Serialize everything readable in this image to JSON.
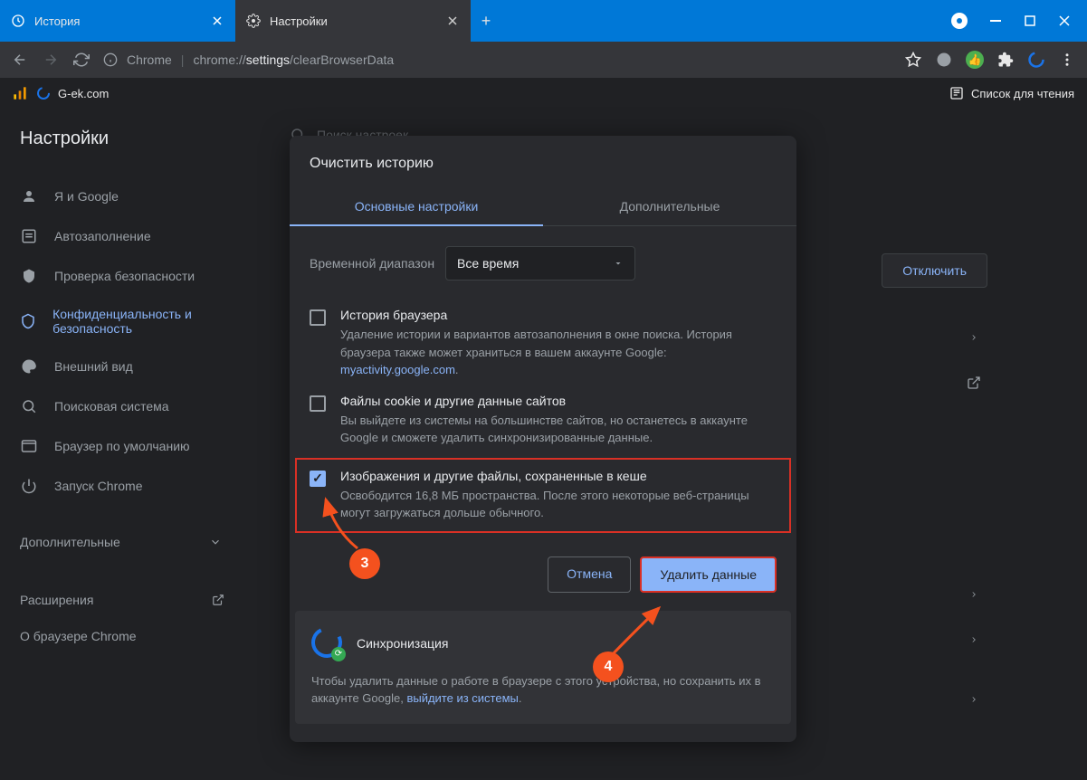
{
  "titlebar": {
    "tabs": [
      {
        "icon": "history-icon",
        "title": "История"
      },
      {
        "icon": "settings-icon",
        "title": "Настройки"
      }
    ],
    "newtab": "+"
  },
  "urlbar": {
    "chrome_label": "Chrome",
    "url_prefix": "chrome://",
    "url_highlight": "settings",
    "url_suffix": "/clearBrowserData"
  },
  "bookmarks": {
    "item1": "G-ek.com",
    "reading_list": "Список для чтения"
  },
  "sidebar": {
    "title": "Настройки",
    "items": [
      {
        "icon": "person-icon",
        "label": "Я и Google"
      },
      {
        "icon": "autofill-icon",
        "label": "Автозаполнение"
      },
      {
        "icon": "shield-icon",
        "label": "Проверка безопасности"
      },
      {
        "icon": "shield-outline-icon",
        "label": "Конфиденциальность и безопасность"
      },
      {
        "icon": "palette-icon",
        "label": "Внешний вид"
      },
      {
        "icon": "search-icon",
        "label": "Поисковая система"
      },
      {
        "icon": "browser-icon",
        "label": "Браузер по умолчанию"
      },
      {
        "icon": "power-icon",
        "label": "Запуск Chrome"
      }
    ],
    "additional": "Дополнительные",
    "extensions": "Расширения",
    "about": "О браузере Chrome"
  },
  "bg": {
    "search_placeholder": "Поиск настроек",
    "disable": "Отключить"
  },
  "dialog": {
    "title": "Очистить историю",
    "tabs": {
      "basic": "Основные настройки",
      "advanced": "Дополнительные"
    },
    "range_label": "Временной диапазон",
    "range_value": "Все время",
    "checks": [
      {
        "title": "История браузера",
        "desc": "Удаление истории и вариантов автозаполнения в окне поиска. История браузера также может храниться в вашем аккаунте Google: ",
        "link": "myactivity.google.com",
        "checked": false
      },
      {
        "title": "Файлы cookie и другие данные сайтов",
        "desc": "Вы выйдете из системы на большинстве сайтов, но останетесь в аккаунте Google и сможете удалить синхронизированные данные.",
        "checked": false
      },
      {
        "title": "Изображения и другие файлы, сохраненные в кеше",
        "desc": "Освободится 16,8 МБ пространства. После этого некоторые веб-страницы могут загружаться дольше обычного.",
        "checked": true
      }
    ],
    "cancel": "Отмена",
    "confirm": "Удалить данные",
    "sync_title": "Синхронизация",
    "sync_desc": "Чтобы удалить данные о работе в браузере с этого устройства, но сохранить их в аккаунте Google, ",
    "sync_link": "выйдите из системы",
    "sync_period": "."
  },
  "annotations": {
    "a3": "3",
    "a4": "4"
  }
}
